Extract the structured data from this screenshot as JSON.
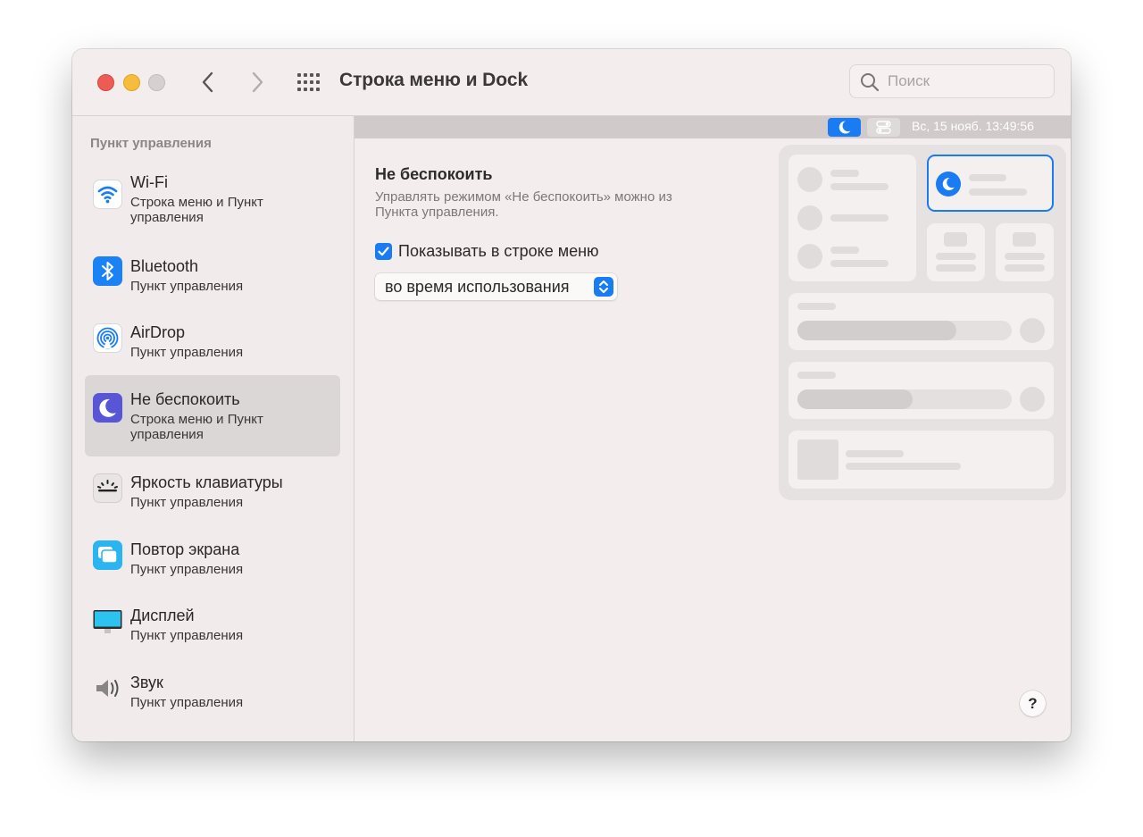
{
  "window": {
    "title": "Строка меню и Dock",
    "search_placeholder": "Поиск"
  },
  "sidebar": {
    "header": "Пункт управления",
    "items": [
      {
        "title": "Wi-Fi",
        "subtitle": "Строка меню и Пункт управления",
        "icon": "wifi-icon"
      },
      {
        "title": "Bluetooth",
        "subtitle": "Пункт управления",
        "icon": "bluetooth-icon"
      },
      {
        "title": "AirDrop",
        "subtitle": "Пункт управления",
        "icon": "airdrop-icon"
      },
      {
        "title": "Не беспокоить",
        "subtitle": "Строка меню и Пункт управления",
        "icon": "moon-icon",
        "selected": true
      },
      {
        "title": "Яркость клавиатуры",
        "subtitle": "Пункт управления",
        "icon": "keyboard-brightness-icon"
      },
      {
        "title": "Повтор экрана",
        "subtitle": "Пункт управления",
        "icon": "screen-mirroring-icon"
      },
      {
        "title": "Дисплей",
        "subtitle": "Пункт управления",
        "icon": "display-icon"
      },
      {
        "title": "Звук",
        "subtitle": "Пункт управления",
        "icon": "speaker-icon"
      }
    ]
  },
  "menubar_preview": {
    "datetime": "Вс, 15 нояб.  13:49:56"
  },
  "main": {
    "section_title": "Не беспокоить",
    "description": "Управлять режимом «Не беспокоить» можно из Пункта управления.",
    "checkbox_label": "Показывать в строке меню",
    "checkbox_checked": true,
    "popup_value": "во время использования"
  },
  "help_label": "?",
  "colors": {
    "accent": "#1a7cf3",
    "close": "#ee5b55",
    "minimize": "#f5bd3b",
    "disabled": "#d6d1d1",
    "window_bg": "#f3eded"
  }
}
